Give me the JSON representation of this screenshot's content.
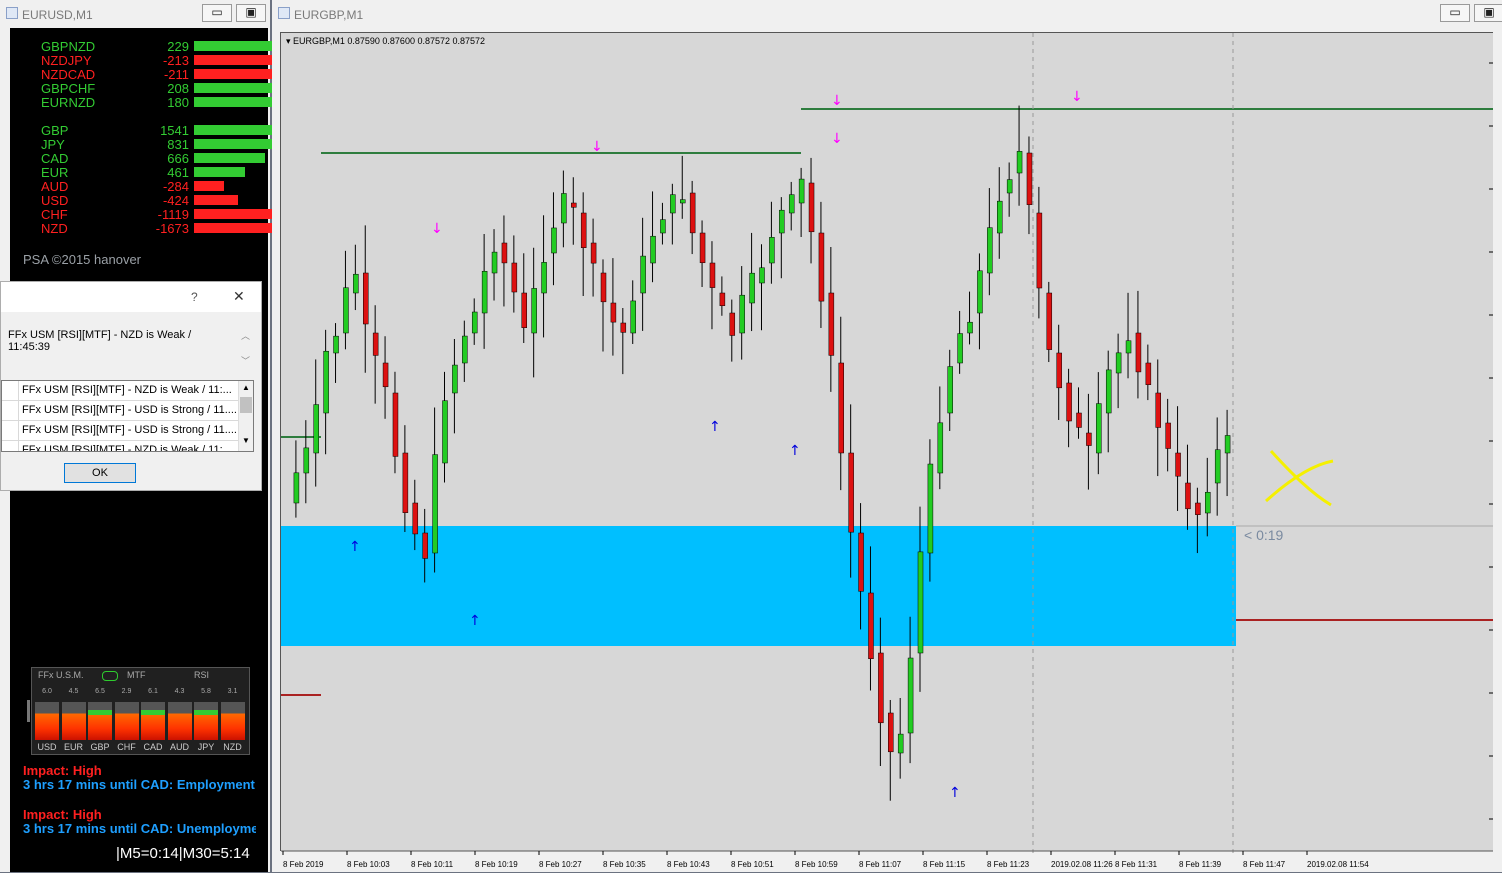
{
  "left_window": {
    "title": "EURUSD,M1",
    "pairs": [
      {
        "name": "GBPNZD",
        "value": "229",
        "level": 1.0,
        "color": "#33cc33"
      },
      {
        "name": "NZDJPY",
        "value": "-213",
        "level": 1.0,
        "color": "#ff2020"
      },
      {
        "name": "NZDCAD",
        "value": "-211",
        "level": 1.0,
        "color": "#ff2020"
      },
      {
        "name": "GBPCHF",
        "value": "208",
        "level": 1.0,
        "color": "#33cc33"
      },
      {
        "name": "EURNZD",
        "value": "180",
        "level": 1.0,
        "color": "#33cc33"
      }
    ],
    "currencies": [
      {
        "name": "GBP",
        "value": "1541",
        "level": 1.0,
        "color": "#33cc33"
      },
      {
        "name": "JPY",
        "value": "831",
        "level": 0.96,
        "color": "#33cc33"
      },
      {
        "name": "CAD",
        "value": "666",
        "level": 0.77,
        "color": "#33cc33"
      },
      {
        "name": "EUR",
        "value": "461",
        "level": 0.55,
        "color": "#33cc33"
      },
      {
        "name": "AUD",
        "value": "-284",
        "level": 0.33,
        "color": "#ff2020"
      },
      {
        "name": "USD",
        "value": "-424",
        "level": 0.48,
        "color": "#ff2020"
      },
      {
        "name": "CHF",
        "value": "-1119",
        "level": 1.0,
        "color": "#ff2020"
      },
      {
        "name": "NZD",
        "value": "-1673",
        "level": 1.0,
        "color": "#ff2020"
      }
    ],
    "copyright": "PSA ©2015 hanover",
    "usm_panel": {
      "title": "FFx U.S.M.",
      "tabs": [
        "MTF",
        "RSI"
      ],
      "values": [
        "6.0",
        "4.5",
        "6.5",
        "2.9",
        "6.1",
        "4.3",
        "5.8",
        "3.1"
      ],
      "labels": [
        "USD",
        "EUR",
        "GBP",
        "CHF",
        "CAD",
        "AUD",
        "JPY",
        "NZD"
      ]
    },
    "news": [
      {
        "impact": "Impact: High",
        "text": "3 hrs 17 mins until CAD: Employment"
      },
      {
        "impact": "Impact: High",
        "text": "3 hrs 17 mins until CAD: Unemployme"
      }
    ],
    "timer": "|M5=0:14|M30=5:14"
  },
  "dialog": {
    "help": "?",
    "close": "✕",
    "message": "FFx USM [RSI][MTF] - NZD is Weak / 11:45:39",
    "rows": [
      "FFx USM [RSI][MTF] - NZD is Weak / 11:...",
      "FFx USM [RSI][MTF] - USD is Strong / 11....",
      "FFx USM [RSI][MTF] - USD is Strong / 11....",
      "FFx USM [RSI][MTF] - NZD is Weak / 11:..."
    ],
    "ok": "OK"
  },
  "right_window": {
    "title": "EURGBP,M1",
    "header": "EURGBP,M1  0.87590 0.87600 0.87572 0.87572",
    "countdown": "< 0:19",
    "time_labels": [
      "8 Feb 2019",
      "8 Feb 10:03",
      "8 Feb 10:11",
      "8 Feb 10:19",
      "8 Feb 10:27",
      "8 Feb 10:35",
      "8 Feb 10:43",
      "8 Feb 10:51",
      "8 Feb 10:59",
      "8 Feb 11:07",
      "8 Feb 11:15",
      "8 Feb 11:23",
      "2019.02.08 11:26",
      "8 Feb 11:31",
      "8 Feb 11:39",
      "8 Feb 11:47",
      "2019.02.08 11:54"
    ]
  },
  "colors": {
    "bull": "#22cc22",
    "bear": "#dd1111",
    "zone": "#00bfff",
    "sell_arrow": "#ff00ff",
    "buy_arrow": "#0000dd",
    "resistance": "#2e7d3e",
    "support": "#aa2222",
    "cross": "#f5f000"
  }
}
